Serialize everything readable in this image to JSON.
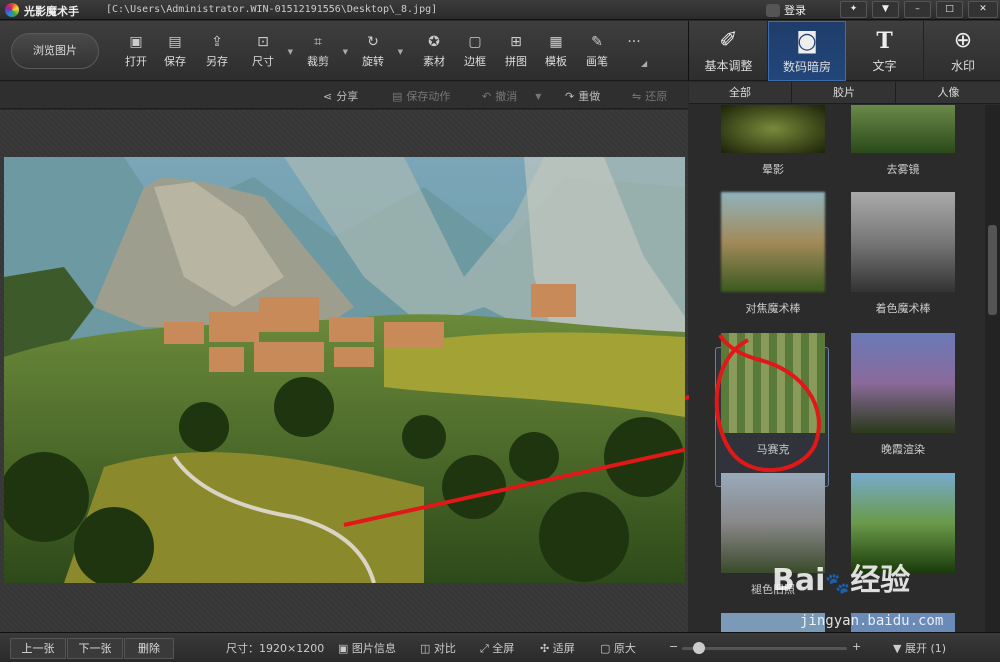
{
  "window": {
    "app_title": "光影魔术手",
    "file_path": "[C:\\Users\\Administrator.WIN-01512191556\\Desktop\\_8.jpg]",
    "login_label": "登录"
  },
  "toolbar": {
    "browse_label": "浏览图片",
    "tools": [
      {
        "label": "打开",
        "icon": "open-icon"
      },
      {
        "label": "保存",
        "icon": "save-icon"
      },
      {
        "label": "另存",
        "icon": "save-as-icon"
      },
      {
        "label": "尺寸",
        "icon": "resize-icon"
      },
      {
        "label": "裁剪",
        "icon": "crop-icon"
      },
      {
        "label": "旋转",
        "icon": "rotate-icon"
      },
      {
        "label": "素材",
        "icon": "material-icon"
      },
      {
        "label": "边框",
        "icon": "border-icon"
      },
      {
        "label": "拼图",
        "icon": "collage-icon"
      },
      {
        "label": "模板",
        "icon": "template-icon"
      },
      {
        "label": "画笔",
        "icon": "brush-icon"
      }
    ],
    "more": "···"
  },
  "right_tabs": [
    {
      "label": "基本调整",
      "icon": "adjust-icon"
    },
    {
      "label": "数码暗房",
      "icon": "darkroom-icon"
    },
    {
      "label": "文字",
      "icon": "text-icon"
    },
    {
      "label": "水印",
      "icon": "watermark-icon"
    }
  ],
  "subbar": {
    "share": "分享",
    "save_action": "保存动作",
    "undo": "撤消",
    "redo": "重做",
    "restore": "还原"
  },
  "filter_tabs": [
    "全部",
    "胶片",
    "人像"
  ],
  "effects": [
    {
      "label": "晕影"
    },
    {
      "label": "去雾镜"
    },
    {
      "label": "对焦魔术棒"
    },
    {
      "label": "着色魔术棒"
    },
    {
      "label": "马赛克"
    },
    {
      "label": "晚霞渲染"
    },
    {
      "label": "褪色旧照"
    },
    {
      "label": ""
    }
  ],
  "status": {
    "prev": "上一张",
    "next": "下一张",
    "delete": "删除",
    "size_label": "尺寸：",
    "size_value": "1920×1200",
    "info": "图片信息",
    "compare": "对比",
    "fullscreen": "全屏",
    "fit": "适屏",
    "original": "原大",
    "expand": "展开 (1)",
    "zoom_fraction": 0.1
  },
  "watermark": {
    "brand": "Bai",
    "brand2": "经验",
    "site": "jingyan.baidu.com"
  }
}
